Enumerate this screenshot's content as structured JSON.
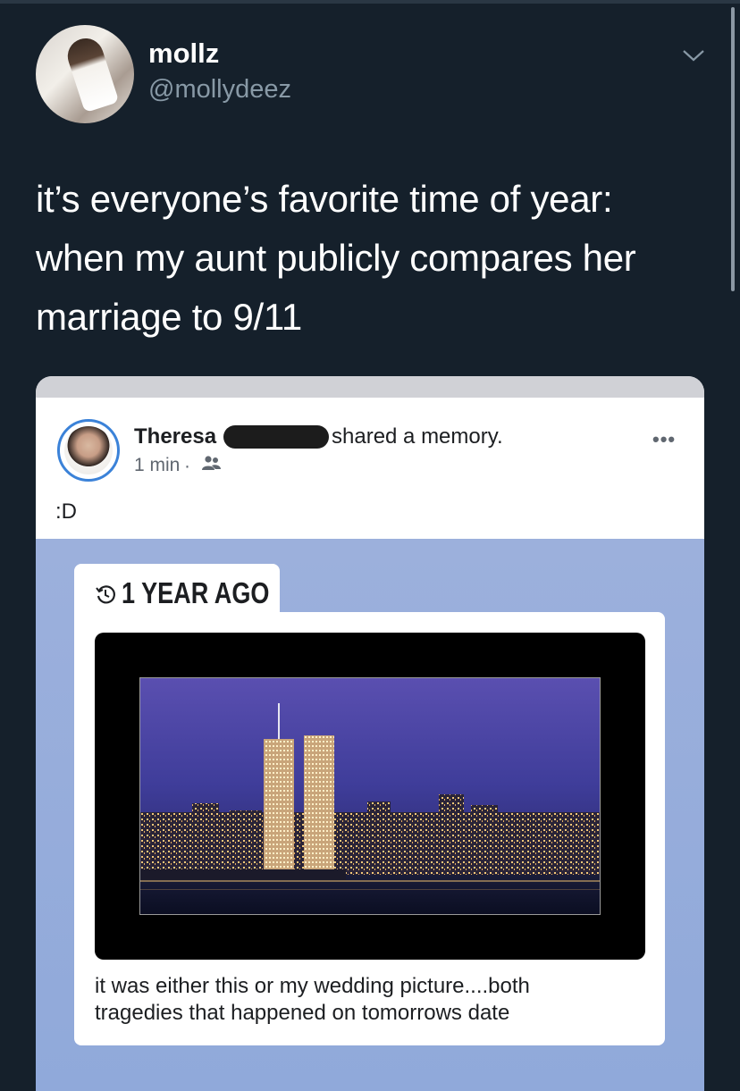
{
  "tweet": {
    "display_name": "mollz",
    "handle": "@mollydeez",
    "text_lines": [
      "it’s everyone’s favorite time of year:",
      "when my aunt publicly compares her",
      "marriage to 9/11"
    ]
  },
  "embedded_post": {
    "author_name": "Theresa",
    "action": "shared a memory.",
    "time": "1 min",
    "separator": "·",
    "audience_icon": "friends-icon",
    "more": "•••",
    "post_text": ":D",
    "memory_label": "1 YEAR AGO",
    "memory_icon": "clock-history-icon",
    "caption_lines": [
      "it was either this or my wedding picture....both",
      "tragedies that happened on tomorrows date"
    ]
  },
  "colors": {
    "background": "#15202b",
    "handle": "#8899a6",
    "memory_background": "#9cb0dc",
    "facebook_blue": "#3b82d8"
  }
}
